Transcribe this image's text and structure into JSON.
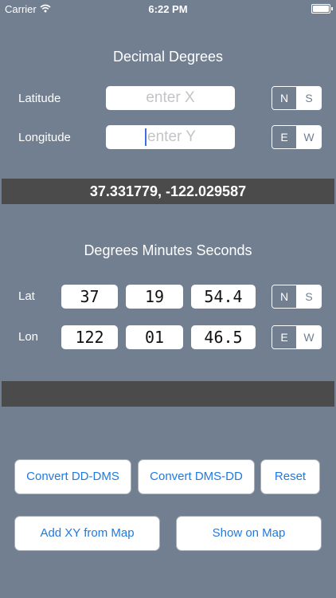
{
  "status_bar": {
    "carrier": "Carrier",
    "time": "6:22 PM"
  },
  "decimal": {
    "title": "Decimal Degrees",
    "latitude_label": "Latitude",
    "latitude_placeholder": "enter X",
    "lat_hemis": [
      "N",
      "S"
    ],
    "longitude_label": "Longitude",
    "longitude_placeholder": "enter Y",
    "lon_hemis": [
      "E",
      "W"
    ],
    "result": "37.331779, -122.029587"
  },
  "dms": {
    "title": "Degrees Minutes Seconds",
    "lat_label": "Lat",
    "lat_deg": "37",
    "lat_min": "19",
    "lat_sec": "54.4",
    "lat_hemis": [
      "N",
      "S"
    ],
    "lon_label": "Lon",
    "lon_deg": "122",
    "lon_min": "01",
    "lon_sec": "46.5",
    "lon_hemis": [
      "E",
      "W"
    ],
    "result": ""
  },
  "buttons": {
    "convert_dd_dms": "Convert DD-DMS",
    "convert_dms_dd": "Convert DMS-DD",
    "reset": "Reset",
    "add_xy": "Add XY from Map",
    "show_map": "Show on Map"
  },
  "colors": {
    "background": "#717f90",
    "bar": "#4b4b4b",
    "button_text": "#1f7ae0"
  },
  "icons": {
    "wifi": "wifi-icon",
    "battery": "battery-icon"
  }
}
